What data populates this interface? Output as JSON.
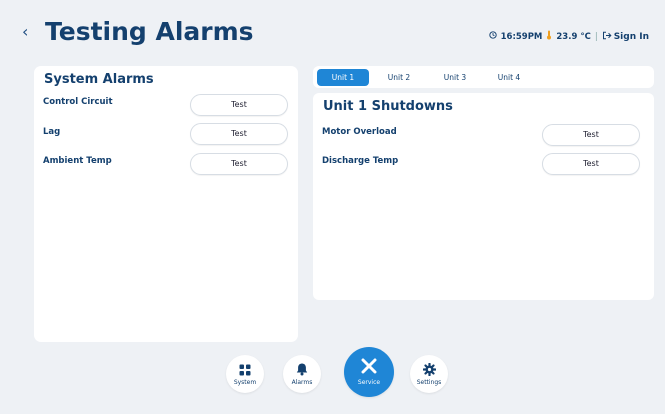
{
  "header": {
    "back_glyph": "‹",
    "title": "Testing Alarms",
    "time_icon": "clock-icon",
    "time": "16:59PM",
    "temp_icon": "thermometer-icon",
    "temperature": "23.9 °C",
    "divider": "|",
    "sign_in_icon": "sign-in-icon",
    "sign_in": "Sign In"
  },
  "system_alarms": {
    "title": "System Alarms",
    "rows": [
      {
        "label": "Control Circuit",
        "button": "Test"
      },
      {
        "label": "Lag",
        "button": "Test"
      },
      {
        "label": "Ambient Temp",
        "button": "Test"
      }
    ]
  },
  "unit_tabs": {
    "tabs": [
      "Unit 1",
      "Unit 2",
      "Unit 3",
      "Unit 4"
    ],
    "active": "Unit 1"
  },
  "unit_shutdowns": {
    "title": "Unit 1 Shutdowns",
    "rows": [
      {
        "label": "Motor Overload",
        "button": "Test"
      },
      {
        "label": "Discharge Temp",
        "button": "Test"
      }
    ]
  },
  "nav": {
    "items": [
      {
        "label": "System",
        "icon": "grid-icon"
      },
      {
        "label": "Alarms",
        "icon": "bell-icon"
      },
      {
        "label": "Service",
        "icon": "tools-icon"
      },
      {
        "label": "Settings",
        "icon": "gear-icon"
      }
    ],
    "active": "Service"
  },
  "colors": {
    "accent": "#1f86d6",
    "title": "#14406e",
    "background": "#eef1f5",
    "panel": "#ffffff"
  }
}
